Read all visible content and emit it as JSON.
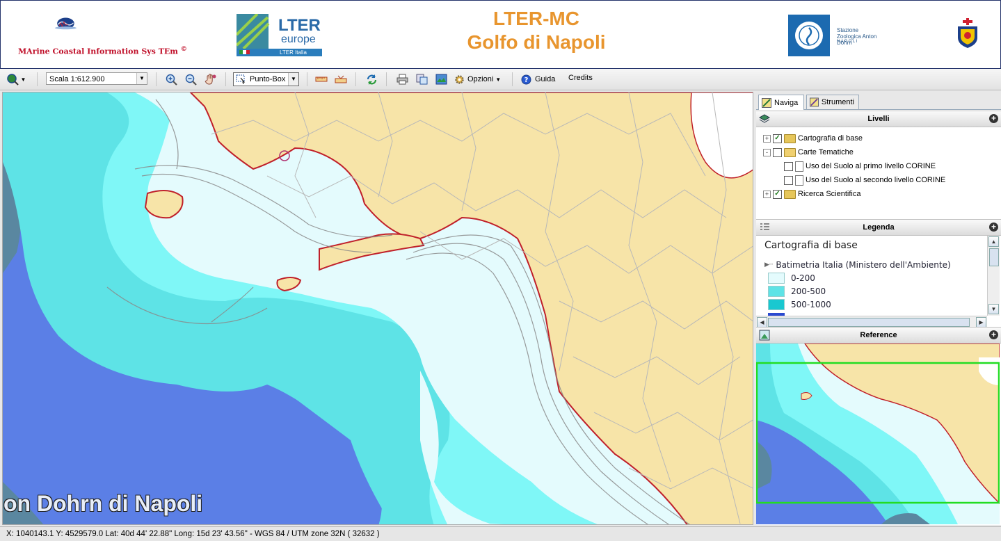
{
  "header": {
    "marine_logo_text_a": "MArine Coastal Information Sys TEm",
    "marine_logo_copyright": "©",
    "lter_logo_big": "LTER",
    "lter_logo_europe": "europe",
    "lter_logo_sub": "LTER Italia",
    "title_line1": "LTER-MC",
    "title_line2": "Golfo di Napoli",
    "szn_logo_text": "Stazione Zoologica Anton Dohrn",
    "szn_logo_sub": "N A P O L I"
  },
  "toolbar": {
    "scale_value": "Scala 1:612.900",
    "select_mode": "Punto-Box",
    "options_label": "Opzioni",
    "guide_label": "Guida",
    "credits_label": "Credits"
  },
  "map": {
    "watermark": "on Dohrn di Napoli",
    "colors": {
      "land": "#f7e4a8",
      "deep": "#5b7fe6",
      "band_500_1000": "#5ee3e6",
      "band_200_500": "#7ff7f7",
      "band_0_200": "#e4fbfd",
      "far_deep": "#5a87a0",
      "coast": "#c0202a"
    }
  },
  "panel": {
    "tabs": [
      {
        "label": "Naviga",
        "active": true
      },
      {
        "label": "Strumenti",
        "active": false
      }
    ],
    "layers_title": "Livelli",
    "layers": [
      {
        "label": "Cartografia di base",
        "checked": true,
        "expander": "+"
      },
      {
        "label": "Carte Tematiche",
        "checked": false,
        "expander": "-"
      },
      {
        "label": "Uso del Suolo al primo livello CORINE",
        "checked": false
      },
      {
        "label": "Uso del Suolo al secondo livello CORINE",
        "checked": false
      },
      {
        "label": "Ricerca Scientifica",
        "checked": true,
        "expander": "+"
      }
    ],
    "legend_title": "Legenda",
    "legend_group": "Cartografia di base",
    "legend_layer": "Batimetria Italia (Ministero dell'Ambiente)",
    "legend_items": [
      {
        "label": "0-200",
        "color": "#e4fbfd"
      },
      {
        "label": "200-500",
        "color": "#5ee3e6"
      },
      {
        "label": "500-1000",
        "color": "#19c8d0"
      }
    ],
    "reference_title": "Reference"
  },
  "status": {
    "text": "X: 1040143.1 Y: 4529579.0 Lat: 40d 44' 22.88\" Long: 15d 23' 43.56\" - WGS 84 / UTM zone 32N ( 32632 )"
  }
}
